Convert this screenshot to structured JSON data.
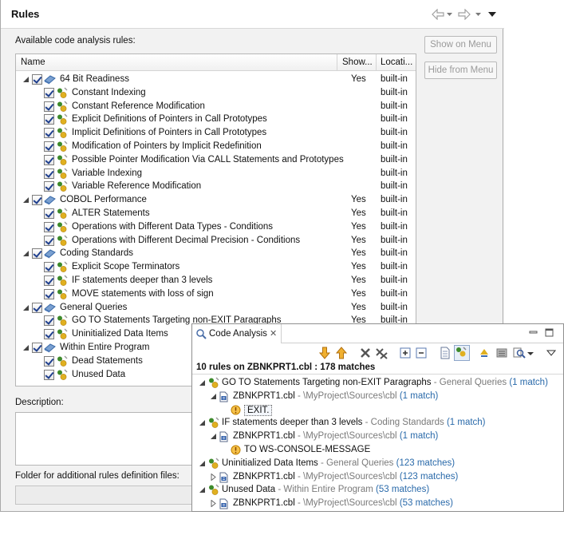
{
  "rules_panel": {
    "title": "Rules",
    "available_label": "Available code analysis rules:",
    "columns": {
      "name": "Name",
      "show": "Show...",
      "location": "Locati..."
    },
    "groups": [
      {
        "label": "64 Bit Readiness",
        "show": "Yes",
        "location": "built-in",
        "rules": [
          {
            "label": "Constant Indexing",
            "show": "",
            "location": "built-in"
          },
          {
            "label": "Constant Reference Modification",
            "show": "",
            "location": "built-in"
          },
          {
            "label": "Explicit Definitions of Pointers in Call Prototypes",
            "show": "",
            "location": "built-in"
          },
          {
            "label": "Implicit Definitions of Pointers in Call Prototypes",
            "show": "",
            "location": "built-in"
          },
          {
            "label": "Modification of Pointers by Implicit Redefinition",
            "show": "",
            "location": "built-in"
          },
          {
            "label": "Possible Pointer Modification Via CALL Statements and Prototypes",
            "show": "",
            "location": "built-in"
          },
          {
            "label": "Variable Indexing",
            "show": "",
            "location": "built-in"
          },
          {
            "label": "Variable Reference Modification",
            "show": "",
            "location": "built-in"
          }
        ]
      },
      {
        "label": "COBOL Performance",
        "show": "Yes",
        "location": "built-in",
        "rules": [
          {
            "label": "ALTER Statements",
            "show": "Yes",
            "location": "built-in"
          },
          {
            "label": "Operations with Different Data Types - Conditions",
            "show": "Yes",
            "location": "built-in"
          },
          {
            "label": "Operations with Different Decimal Precision - Conditions",
            "show": "Yes",
            "location": "built-in"
          }
        ]
      },
      {
        "label": "Coding Standards",
        "show": "Yes",
        "location": "built-in",
        "rules": [
          {
            "label": "Explicit Scope Terminators",
            "show": "Yes",
            "location": "built-in"
          },
          {
            "label": "IF statements deeper than 3 levels",
            "show": "Yes",
            "location": "built-in"
          },
          {
            "label": "MOVE statements with loss of sign",
            "show": "Yes",
            "location": "built-in"
          }
        ]
      },
      {
        "label": "General Queries",
        "show": "Yes",
        "location": "built-in",
        "rules": [
          {
            "label": "GO TO Statements Targeting non-EXIT Paragraphs",
            "show": "Yes",
            "location": "built-in"
          },
          {
            "label": "Uninitialized Data Items",
            "show": "",
            "location": ""
          }
        ]
      },
      {
        "label": "Within Entire Program",
        "show": "",
        "location": "",
        "rules": [
          {
            "label": "Dead Statements",
            "show": "",
            "location": ""
          },
          {
            "label": "Unused Data",
            "show": "",
            "location": ""
          }
        ]
      }
    ],
    "buttons": {
      "show_on_menu": "Show on Menu",
      "hide_from_menu": "Hide from Menu"
    },
    "description_label": "Description:",
    "folder_label": "Folder for additional rules definition files:"
  },
  "code_analysis": {
    "tab_title": "Code Analysis",
    "tab_close": "✕",
    "summary": "10 rules on ZBNKPRT1.cbl : 178 matches",
    "results": [
      {
        "rule": "GO TO Statements Targeting non-EXIT Paragraphs",
        "sep": " - ",
        "category": "General Queries",
        "count": "(1 match)",
        "file": "ZBNKPRT1.cbl",
        "file_sep": " - ",
        "path": "\\MyProject\\Sources\\cbl",
        "file_count": "(1 match)",
        "match": "EXIT."
      },
      {
        "rule": "IF statements deeper than 3 levels",
        "sep": " - ",
        "category": "Coding Standards",
        "count": "(1 match)",
        "file": "ZBNKPRT1.cbl",
        "file_sep": " - ",
        "path": "\\MyProject\\Sources\\cbl",
        "file_count": "(1 match)",
        "match": "TO WS-CONSOLE-MESSAGE"
      },
      {
        "rule": "Uninitialized Data Items",
        "sep": " - ",
        "category": "General Queries",
        "count": "(123 matches)",
        "file": "ZBNKPRT1.cbl",
        "file_sep": " - ",
        "path": "\\MyProject\\Sources\\cbl",
        "file_count": "(123 matches)"
      },
      {
        "rule": "Unused Data",
        "sep": " - ",
        "category": "Within Entire Program",
        "count": "(53 matches)",
        "file": "ZBNKPRT1.cbl",
        "file_sep": " - ",
        "path": "\\MyProject\\Sources\\cbl",
        "file_count": "(53 matches)"
      }
    ]
  },
  "colors": {
    "link_blue": "#2a6aaa",
    "category_gray": "#7a7a7a",
    "rule_green": "#3d8a2a",
    "rule_yellow": "#e0b020",
    "down_arrow": "#e8a020"
  }
}
